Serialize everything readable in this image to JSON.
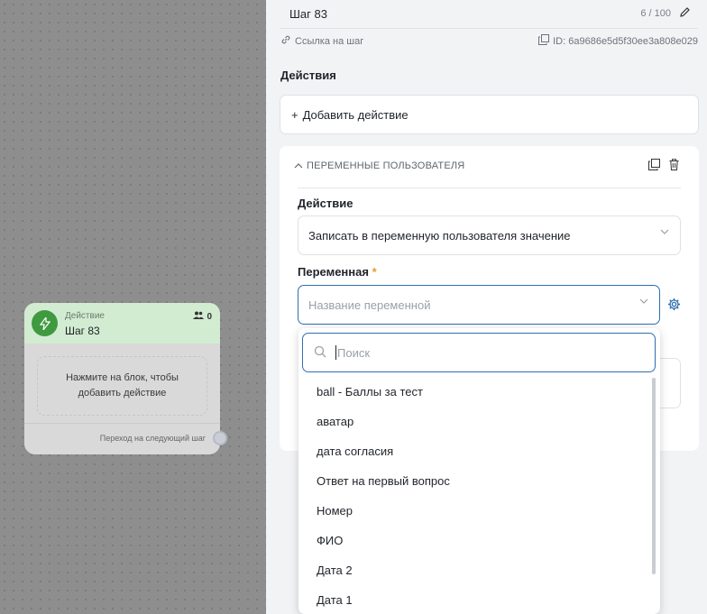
{
  "canvas": {
    "node": {
      "type_label": "Действие",
      "title": "Шаг 83",
      "users_count": "0",
      "body_text": "Нажмите на блок, чтобы добавить действие",
      "next_label": "Переход на следующий шаг"
    }
  },
  "panel": {
    "step_name": "Шаг 83",
    "step_counter": "6 / 100",
    "link_label": "Ссылка на шаг",
    "id_label": "ID: 6a9686e5d5f30ee3a808e029",
    "actions_title": "Действия",
    "add_action_label": "Добавить действие",
    "card": {
      "title": "ПЕРЕМЕННЫЕ ПОЛЬЗОВАТЕЛЯ",
      "action_label": "Действие",
      "action_value": "Записать в переменную пользователя значение",
      "variable_label": "Переменная",
      "required_mark": "*",
      "variable_placeholder": "Название переменной"
    }
  },
  "dropdown": {
    "search_placeholder": "Поиск",
    "options": [
      "ball - Баллы за тест",
      "аватар",
      "дата согласия",
      "Ответ на первый вопрос",
      "Номер",
      "ФИО",
      "Дата 2",
      "Дата 1"
    ]
  }
}
